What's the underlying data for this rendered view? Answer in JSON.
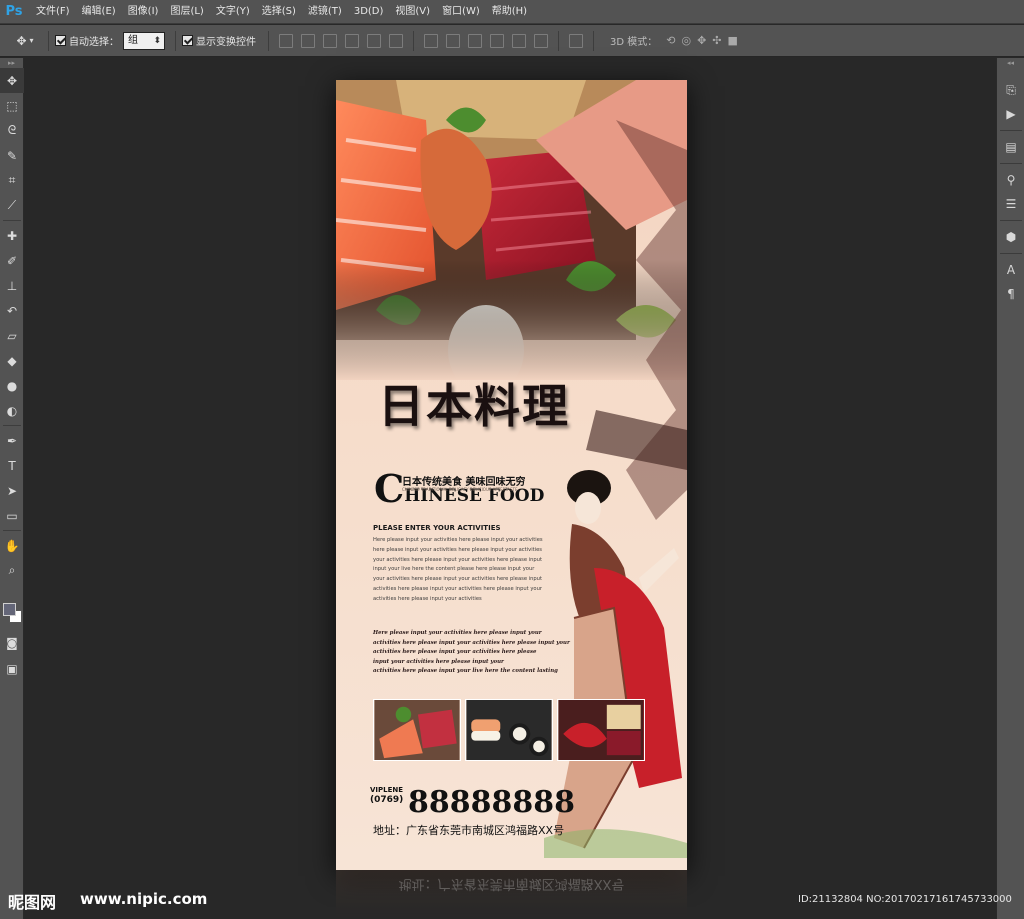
{
  "app": {
    "logo": "Ps"
  },
  "menu": [
    "文件(F)",
    "编辑(E)",
    "图像(I)",
    "图层(L)",
    "文字(Y)",
    "选择(S)",
    "滤镜(T)",
    "3D(D)",
    "视图(V)",
    "窗口(W)",
    "帮助(H)"
  ],
  "options": {
    "auto_select_label": "自动选择：",
    "auto_select_value": "组",
    "show_transform_label": "显示变换控件",
    "mode_3d_label": "3D 模式："
  },
  "tools": [
    "move-tool",
    "marquee-tool",
    "lasso-tool",
    "quick-select-tool",
    "crop-tool",
    "eyedropper-tool",
    "healing-brush-tool",
    "brush-tool",
    "clone-stamp-tool",
    "history-brush-tool",
    "eraser-tool",
    "paint-bucket-tool",
    "blur-tool",
    "dodge-tool",
    "pen-tool",
    "type-tool",
    "path-select-tool",
    "shape-tool",
    "hand-tool",
    "zoom-tool"
  ],
  "colors": {
    "foreground": "#646678",
    "background": "#ffffff",
    "ui_panel": "#535353",
    "canvas_bg": "#282828"
  },
  "poster": {
    "title_cn": "日本料理",
    "subtitle_cn": "日本传统美食  美味回味无穷",
    "tiny_en": "CHINESE TRADITIONAL DELICACY DELICIOUS AFTERTASTE",
    "title_en_first": "C",
    "title_en_rest": "HINESE FOOD",
    "section_heading": "PLEASE ENTER YOUR ACTIVITIES",
    "body_lines": [
      "Here please input your activities here please input your activities",
      "here please input your activities here please input your activities",
      "your activities here please input your activities here please input",
      "input your live here the content please here please input your",
      "your activities here please input your activities here please input",
      "activities here please input your activities here please input your",
      "activities here please input your activities"
    ],
    "italic_lines": [
      "Here please input your activities here please input your",
      "activities here please input your activities here please input your",
      "activities here please input your activities here please",
      "input your activities here please input your",
      "activities here please input your live here the content lasting"
    ],
    "phone_brand": "VIPLENE",
    "phone_area": "(0769)",
    "phone_number": "88888888",
    "address": "地址：广东省东莞市南城区鸿福路XX号"
  },
  "watermark": {
    "logo": "昵图网",
    "url": "www.nipic.com",
    "id": "ID:21132804 NO:20170217161745733000"
  }
}
